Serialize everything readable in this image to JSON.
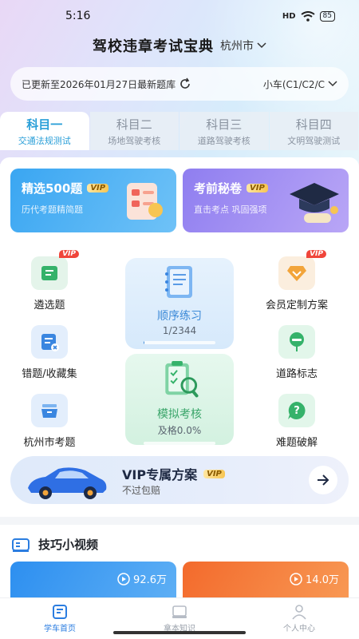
{
  "status_bar": {
    "time": "5:16",
    "signal": "HD",
    "battery": "85"
  },
  "header": {
    "app_title": "驾校违章考试宝典",
    "city": "杭州市"
  },
  "update_bar": {
    "text": "已更新至2026年01月27日最新题库",
    "car_type": "小车(C1/C2/C"
  },
  "subject_tabs": [
    {
      "title": "科目一",
      "subtitle": "交通法规测试",
      "active": true
    },
    {
      "title": "科目二",
      "subtitle": "场地驾驶考核",
      "active": false
    },
    {
      "title": "科目三",
      "subtitle": "道路驾驶考核",
      "active": false
    },
    {
      "title": "科目四",
      "subtitle": "文明驾驶测试",
      "active": false
    }
  ],
  "promos": [
    {
      "title": "精选500题",
      "tag": "VIP",
      "subtitle": "历代考题精简题"
    },
    {
      "title": "考前秘卷",
      "tag": "VIP",
      "subtitle": "直击考点 巩固强项"
    }
  ],
  "grid": {
    "curated": {
      "label": "遴选题",
      "badge": "VIP"
    },
    "wrong": {
      "label": "错题/收藏集"
    },
    "city": {
      "label": "杭州市考题"
    },
    "member": {
      "label": "会员定制方案",
      "badge": "VIP"
    },
    "signs": {
      "label": "道路标志"
    },
    "hard": {
      "label": "难题破解"
    }
  },
  "sequential": {
    "title": "顺序练习",
    "progress_text": "1/2344",
    "progress": 0.0004
  },
  "mock_exam": {
    "title": "模拟考核",
    "pass_text": "及格0.0%",
    "progress": 0.0
  },
  "vip_banner": {
    "title": "VIP专属方案",
    "tag": "VIP",
    "subtitle": "不过包赔"
  },
  "videos": {
    "title": "技巧小视频",
    "items": [
      {
        "views": "92.6万"
      },
      {
        "views": "14.0万"
      }
    ]
  },
  "nav": [
    {
      "label": "学车首页",
      "active": true
    },
    {
      "label": "拿本知识",
      "active": false
    },
    {
      "label": "个人中心",
      "active": false
    }
  ],
  "colors": {
    "accent": "#2a9fd8",
    "nav_active": "#2b7de0",
    "vip_red": "#f0453a"
  }
}
